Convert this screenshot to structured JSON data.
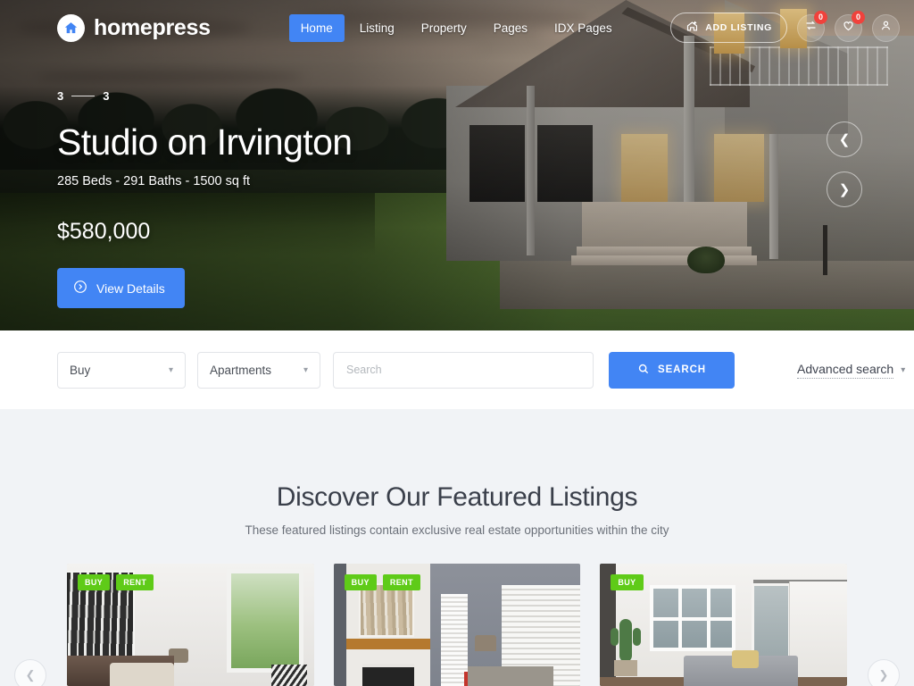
{
  "brand": {
    "name": "homepress",
    "logo_icon": "home-icon",
    "accent_color": "#4285f4"
  },
  "nav": {
    "items": [
      {
        "label": "Home",
        "active": true
      },
      {
        "label": "Listing",
        "active": false
      },
      {
        "label": "Property",
        "active": false
      },
      {
        "label": "Pages",
        "active": false
      },
      {
        "label": "IDX Pages",
        "active": false
      }
    ]
  },
  "header_actions": {
    "add_listing_label": "ADD LISTING",
    "add_listing_icon": "home-plus-icon",
    "compare": {
      "icon": "compare-icon",
      "badge": "0"
    },
    "favorites": {
      "icon": "heart-icon",
      "badge": "0"
    },
    "account": {
      "icon": "user-icon"
    }
  },
  "hero": {
    "slide_current": "3",
    "slide_total": "3",
    "title": "Studio on Irvington",
    "meta": "285 Beds - 291 Baths - 1500 sq ft",
    "price": "$580,000",
    "cta_label": "View Details",
    "cta_icon": "arrow-circle-right-icon",
    "prev_icon": "chevron-left-icon",
    "next_icon": "chevron-right-icon"
  },
  "search": {
    "purpose_value": "Buy",
    "type_value": "Apartments",
    "query_value": "",
    "query_placeholder": "Search",
    "button_label": "SEARCH",
    "button_icon": "search-icon",
    "advanced_label": "Advanced search",
    "advanced_icon": "chevron-down-icon",
    "chevron_icon": "chevron-down-icon"
  },
  "featured": {
    "title": "Discover Our Featured Listings",
    "subtitle": "These featured listings contain exclusive real estate opportunities within the city",
    "cards": [
      {
        "badges": [
          "BUY",
          "RENT"
        ],
        "image_alt": "bright-living-room-with-abstract-art"
      },
      {
        "badges": [
          "BUY",
          "RENT"
        ],
        "image_alt": "living-room-with-fireplace-and-blinds"
      },
      {
        "badges": [
          "BUY"
        ],
        "image_alt": "white-room-with-cactus-and-barn-door"
      }
    ],
    "badge_color": "#5fcb18",
    "prev_icon": "chevron-left-icon",
    "next_icon": "chevron-right-icon"
  }
}
